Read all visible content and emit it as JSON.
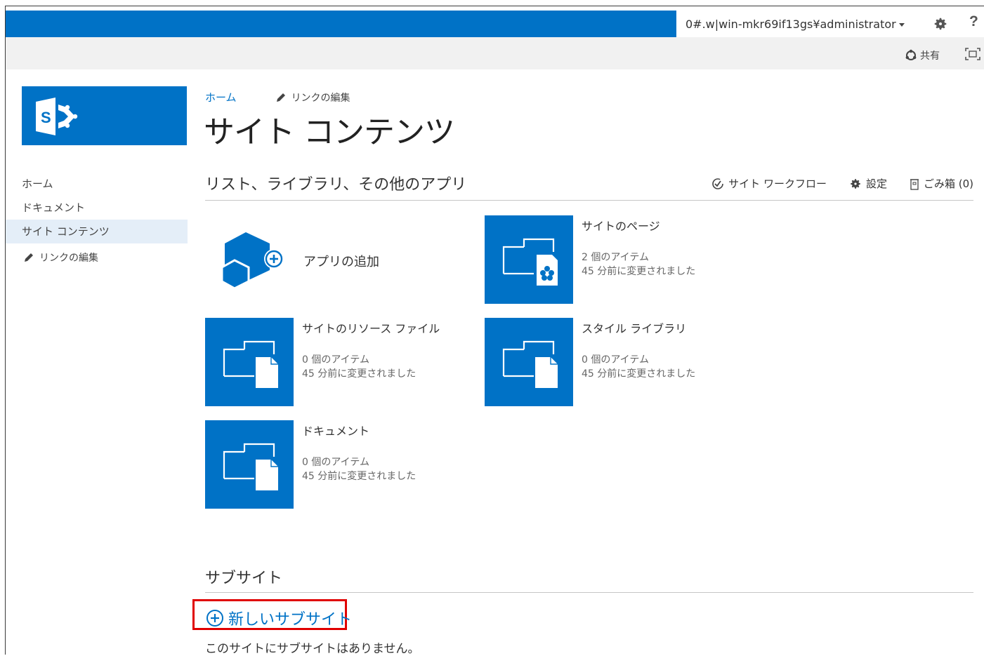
{
  "suite_bar": {
    "user": "0#.w|win-mkr69if13gs¥administrator",
    "help_label": "?",
    "share_label": "共有"
  },
  "left_nav": {
    "items": [
      {
        "label": "ホーム"
      },
      {
        "label": "ドキュメント"
      },
      {
        "label": "サイト コンテンツ"
      }
    ],
    "edit_links": "リンクの編集"
  },
  "breadcrumb": {
    "home": "ホーム",
    "edit_links": "リンクの編集"
  },
  "page_title": "サイト コンテンツ",
  "apps_section": {
    "title": "リスト、ライブラリ、その他のアプリ",
    "actions": {
      "workflow": "サイト ワークフロー",
      "settings": "設定",
      "recycle_bin": "ごみ箱 (0)"
    },
    "add_app": "アプリの追加",
    "tiles": [
      {
        "title": "サイトのページ",
        "items": "2 個のアイテム",
        "modified": "45 分前に変更されました"
      },
      {
        "title": "サイトのリソース ファイル",
        "items": "0 個のアイテム",
        "modified": "45 分前に変更されました"
      },
      {
        "title": "スタイル ライブラリ",
        "items": "0 個のアイテム",
        "modified": "45 分前に変更されました"
      },
      {
        "title": "ドキュメント",
        "items": "0 個のアイテム",
        "modified": "45 分前に変更されました"
      }
    ]
  },
  "subsites": {
    "title": "サブサイト",
    "new_label": "新しいサブサイト",
    "empty_message": "このサイトにサブサイトはありません。"
  },
  "colors": {
    "brand_blue": "#0072c6",
    "highlight_red": "#e00000",
    "nav_selected": "#e4eef8"
  }
}
